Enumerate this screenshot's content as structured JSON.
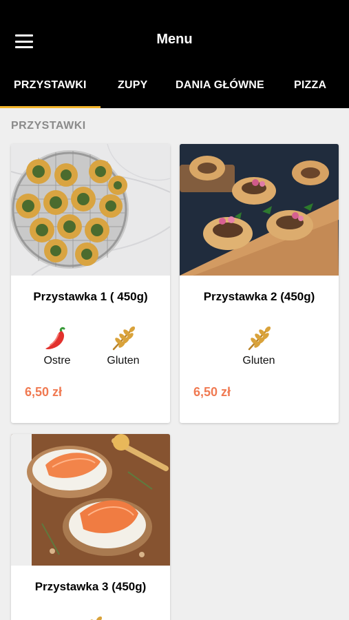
{
  "header": {
    "title": "Menu",
    "menu_icon": "hamburger-menu-icon"
  },
  "tabs": [
    {
      "label": "PRZYSTAWKI",
      "active": true
    },
    {
      "label": "ZUPY",
      "active": false
    },
    {
      "label": "DANIA GŁÓWNE",
      "active": false
    },
    {
      "label": "PIZZA",
      "active": false
    }
  ],
  "section": {
    "label": "PRZYSTAWKI"
  },
  "products": [
    {
      "name": "Przystawka 1 ( 450g)",
      "price": "6,50 zł",
      "tags": [
        {
          "label": "Ostre",
          "icon": "chili-pepper-icon"
        },
        {
          "label": "Gluten",
          "icon": "wheat-icon"
        }
      ]
    },
    {
      "name": "Przystawka 2 (450g)",
      "price": "6,50 zł",
      "tags": [
        {
          "label": "Gluten",
          "icon": "wheat-icon"
        }
      ]
    },
    {
      "name": "Przystawka 3 (450g)",
      "price": "",
      "tags": [
        {
          "label": "",
          "icon": "wheat-icon"
        }
      ]
    }
  ],
  "colors": {
    "accent": "#f2b42a",
    "price": "#f07a52",
    "header_bg": "#000000",
    "page_bg": "#efefef"
  }
}
